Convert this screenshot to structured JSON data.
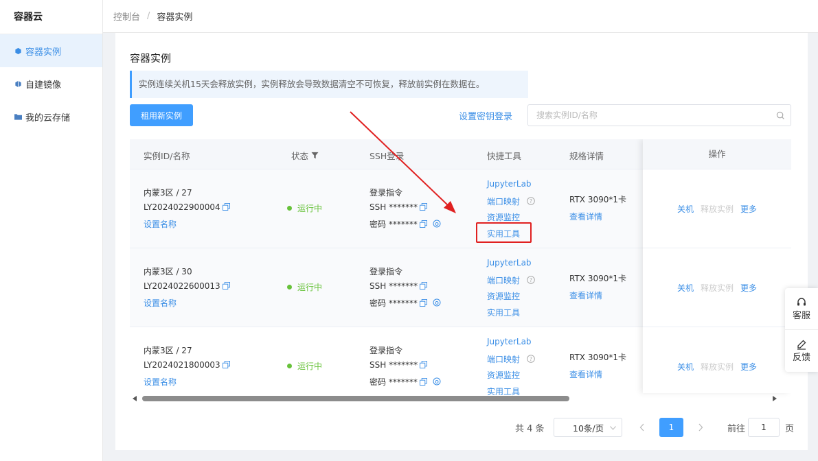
{
  "sidebar": {
    "brand": "容器云",
    "items": [
      {
        "label": "容器实例"
      },
      {
        "label": "自建镜像"
      },
      {
        "label": "我的云存储"
      }
    ]
  },
  "breadcrumb": {
    "root": "控制台",
    "sep": "/",
    "current": "容器实例"
  },
  "page": {
    "title": "容器实例",
    "notice": "实例连续关机15天会释放实例，实例释放会导致数据清空不可恢复，释放前实例在数据在。",
    "rent_button": "租用新实例",
    "key_login": "设置密钥登录",
    "search_placeholder": "搜索实例ID/名称"
  },
  "table": {
    "headers": {
      "id": "实例ID/名称",
      "status": "状态",
      "ssh": "SSH登录",
      "tools": "快捷工具",
      "spec": "规格详情",
      "ops": "操作"
    },
    "rows": [
      {
        "region": "内蒙3区 / 27",
        "id": "LY2024022900004",
        "set_name": "设置名称",
        "status": "运行中",
        "ssh_title": "登录指令",
        "ssh_cmd": "SSH *******",
        "ssh_pwd": "密码 *******",
        "tool_1": "JupyterLab",
        "tool_2": "端口映射",
        "tool_3": "资源监控",
        "tool_4": "实用工具",
        "spec": "RTX 3090*1卡",
        "spec_link": "查看详情",
        "op_1": "关机",
        "op_2": "释放实例",
        "op_3": "更多"
      },
      {
        "region": "内蒙3区 / 30",
        "id": "LY2024022600013",
        "set_name": "设置名称",
        "status": "运行中",
        "ssh_title": "登录指令",
        "ssh_cmd": "SSH *******",
        "ssh_pwd": "密码 *******",
        "tool_1": "JupyterLab",
        "tool_2": "端口映射",
        "tool_3": "资源监控",
        "tool_4": "实用工具",
        "spec": "RTX 3090*1卡",
        "spec_link": "查看详情",
        "op_1": "关机",
        "op_2": "释放实例",
        "op_3": "更多"
      },
      {
        "region": "内蒙3区 / 27",
        "id": "LY2024021800003",
        "set_name": "设置名称",
        "status": "运行中",
        "ssh_title": "登录指令",
        "ssh_cmd": "SSH *******",
        "ssh_pwd": "密码 *******",
        "tool_1": "JupyterLab",
        "tool_2": "端口映射",
        "tool_3": "资源监控",
        "tool_4": "实用工具",
        "spec": "RTX 3090*1卡",
        "spec_link": "查看详情",
        "op_1": "关机",
        "op_2": "释放实例",
        "op_3": "更多"
      }
    ]
  },
  "pagination": {
    "total": "共 4 条",
    "page_size": "10条/页",
    "current_page": "1",
    "goto_label": "前往",
    "goto_value": "1",
    "page_suffix": "页"
  },
  "float": {
    "service": "客服",
    "feedback": "反馈"
  },
  "colors": {
    "primary": "#409eff",
    "success": "#67c23a",
    "highlight": "#e02020"
  }
}
